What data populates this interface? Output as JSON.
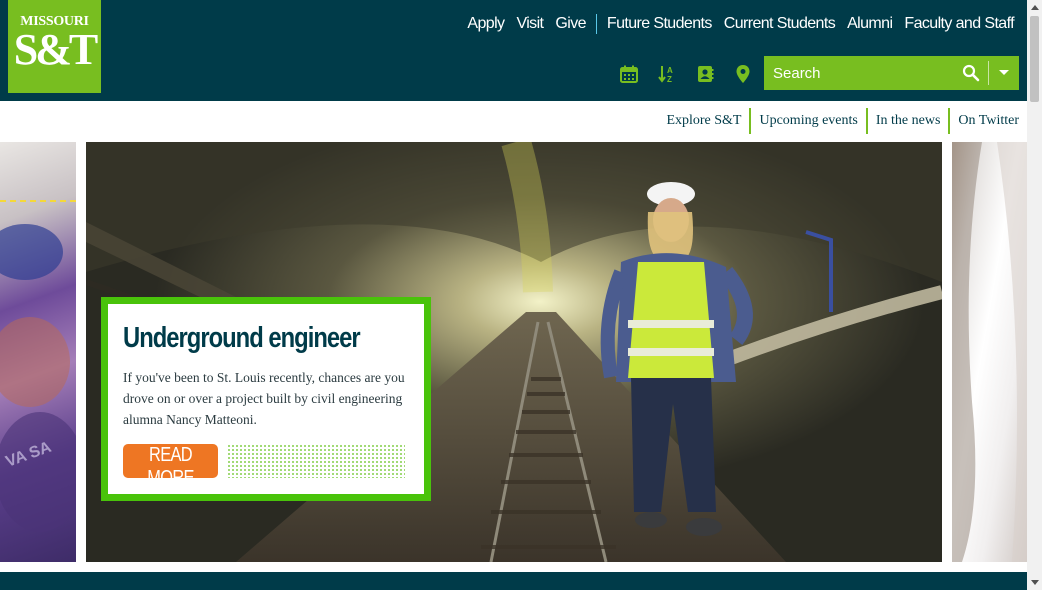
{
  "logo": {
    "line1": "MISSOURI",
    "mark": "S&T"
  },
  "topnav": {
    "primary": [
      "Apply",
      "Visit",
      "Give"
    ],
    "audiences": [
      "Future Students",
      "Current Students",
      "Alumni",
      "Faculty and Staff"
    ]
  },
  "tools": {
    "calendar_icon": "calendar-icon",
    "az_icon": "a-z-sort-icon",
    "directory_icon": "directory-icon",
    "map_icon": "map-pin-icon"
  },
  "search": {
    "placeholder": "Search",
    "value": ""
  },
  "subnav": [
    "Explore S&T",
    "Upcoming events",
    "In the news",
    "On Twitter"
  ],
  "slide": {
    "title": "Underground engineer",
    "body": "If you've been to St. Louis recently, chances are you drove on or over a project built by civil engineering alumna Nancy Matteoni.",
    "cta": "READ MORE"
  },
  "colors": {
    "header": "#003b49",
    "brand_green": "#78be20",
    "card_border": "#49c30a",
    "cta": "#ee7623"
  }
}
